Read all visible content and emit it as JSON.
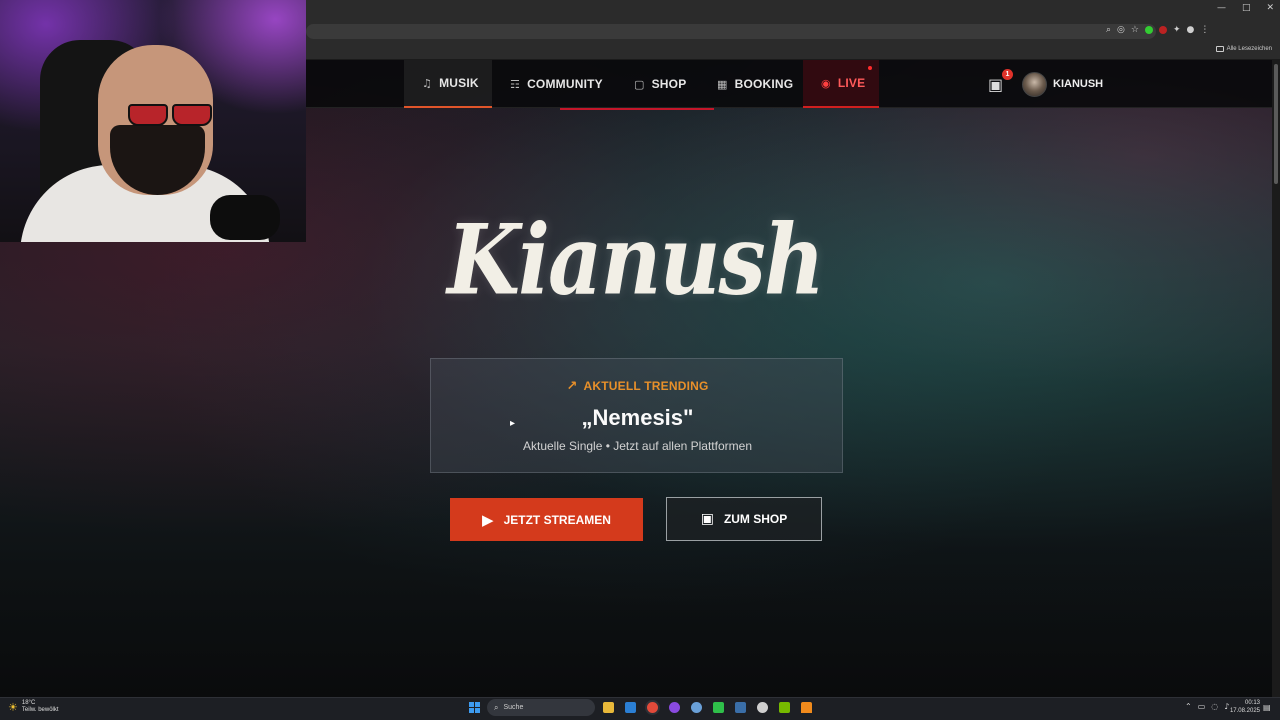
{
  "browser": {
    "window_controls": [
      "—",
      "□",
      "✕"
    ],
    "bookmark_folder": "Alle Lesezeichen"
  },
  "nav": {
    "items": [
      {
        "label": "MUSIK",
        "icon": "music-note-icon",
        "glyph": "♫"
      },
      {
        "label": "COMMUNITY",
        "icon": "users-icon",
        "glyph": "☶"
      },
      {
        "label": "SHOP",
        "icon": "shopping-bag-icon",
        "glyph": "▢"
      },
      {
        "label": "BOOKING",
        "icon": "calendar-icon",
        "glyph": "▦"
      },
      {
        "label": "LIVE",
        "icon": "broadcast-icon",
        "glyph": "◉"
      }
    ],
    "cart_count": "1",
    "cart_glyph": "▣",
    "username": "KIANUSH"
  },
  "hero": {
    "logo_text": "Kianush",
    "trending_label": "AKTUELL TRENDING",
    "trending_glyph": "↗",
    "song_title": "„Nemesis\"",
    "song_subtitle": "Aktuelle Single • Jetzt auf allen Plattformen",
    "stream_button": "JETZT STREAMEN",
    "stream_glyph": "▶",
    "shop_button": "ZUM SHOP",
    "shop_glyph": "▣"
  },
  "taskbar": {
    "weather_temp": "18°C",
    "weather_desc": "Teilw. bewölkt",
    "weather_glyph": "☀",
    "search_placeholder": "Suche",
    "search_glyph": "⌕",
    "time": "00:13",
    "date": "17.08.2025",
    "tray_glyphs": [
      "⌃",
      "▭",
      "◌",
      "♪"
    ],
    "notif_glyph": "▤"
  },
  "colors": {
    "accent_orange": "#e0552a",
    "stream_red": "#d43a1c",
    "live_red": "#d01f1f",
    "trending_orange": "#e8902a"
  }
}
